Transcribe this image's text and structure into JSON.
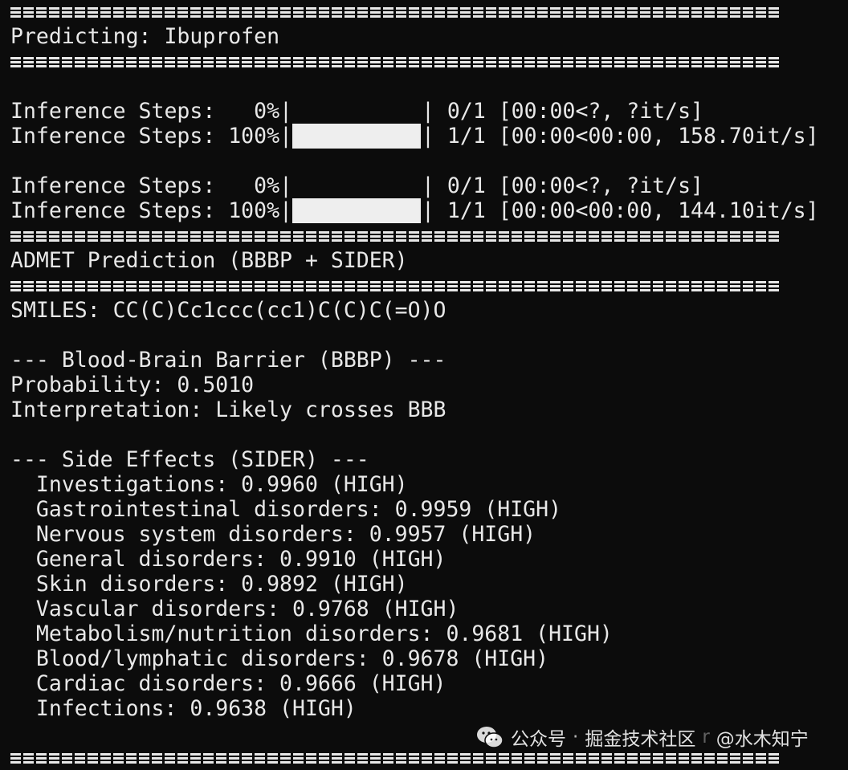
{
  "header": {
    "predicting": "Predicting: Ibuprofen"
  },
  "progress": [
    {
      "label": "Inference Steps:   0%|",
      "end": "| 0/1 [00:00<?, ?it/s]",
      "fraction": 0.0
    },
    {
      "label": "Inference Steps: 100%|",
      "end": "| 1/1 [00:00<00:00, 158.70it/s]",
      "fraction": 1.0
    },
    {
      "label": "Inference Steps:   0%|",
      "end": "| 0/1 [00:00<?, ?it/s]",
      "fraction": 0.0
    },
    {
      "label": "Inference Steps: 100%|",
      "end": "| 1/1 [00:00<00:00, 144.10it/s]",
      "fraction": 1.0
    }
  ],
  "admet": {
    "title": "ADMET Prediction (BBBP + SIDER)",
    "smiles": "SMILES: CC(C)Cc1ccc(cc1)C(C)C(=O)O"
  },
  "bbbp": {
    "heading": "--- Blood-Brain Barrier (BBBP) ---",
    "probability": "Probability: 0.5010",
    "interpretation": "Interpretation: Likely crosses BBB"
  },
  "sider": {
    "heading": "--- Side Effects (SIDER) ---",
    "items": [
      "  Investigations: 0.9960 (HIGH)",
      "  Gastrointestinal disorders: 0.9959 (HIGH)",
      "  Nervous system disorders: 0.9957 (HIGH)",
      "  General disorders: 0.9910 (HIGH)",
      "  Skin disorders: 0.9892 (HIGH)",
      "  Vascular disorders: 0.9768 (HIGH)",
      "  Metabolism/nutrition disorders: 0.9681 (HIGH)",
      "  Blood/lymphatic disorders: 0.9678 (HIGH)",
      "  Cardiac disorders: 0.9666 (HIGH)",
      "  Infections: 0.9638 (HIGH)"
    ]
  },
  "watermark": {
    "icon": "wechat-icon",
    "account": "公众号",
    "separator": "·",
    "site": "掘金技术社区",
    "faded": "r",
    "author": "@水木知宁"
  },
  "colors": {
    "background": "#0c0c0c",
    "foreground": "#e8e8e8",
    "bar_fill": "#eeeeee"
  }
}
